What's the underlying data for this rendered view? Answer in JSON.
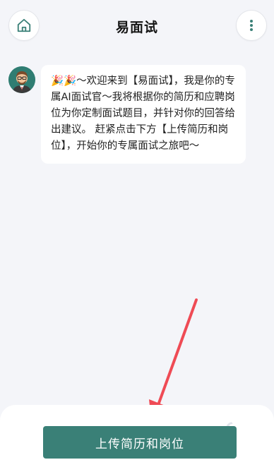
{
  "header": {
    "title": "易面试",
    "home_icon": "home-icon",
    "more_icon": "more-vertical-icon"
  },
  "chat": {
    "avatar_icon": "interviewer-avatar",
    "message_emoji": "🎉🎉",
    "message_text": "～欢迎来到【易面试】，我是你的专属AI面试官～我将根据你的简历和应聘岗位为你定制面试题目，并针对你的回答给出建议。 赶紧点击下方【上传简历和岗位】，开始你的专属面试之旅吧～"
  },
  "bottom": {
    "upload_label": "上传简历和岗位"
  },
  "colors": {
    "accent": "#3a8077",
    "background": "#f4f5f9",
    "annotation_arrow": "#ef4b55"
  },
  "watermark_text": "z.c"
}
